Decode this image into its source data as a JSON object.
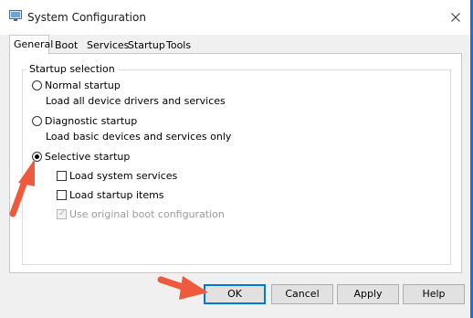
{
  "window": {
    "title": "System Configuration",
    "icon": "system-config-icon",
    "close_icon": "close-icon"
  },
  "tabs": [
    {
      "label": "General",
      "active": true
    },
    {
      "label": "Boot",
      "active": false
    },
    {
      "label": "Services",
      "active": false
    },
    {
      "label": "Startup",
      "active": false
    },
    {
      "label": "Tools",
      "active": false
    }
  ],
  "startup_selection": {
    "group_label": "Startup selection",
    "normal": {
      "label": "Normal startup",
      "description": "Load all device drivers and services",
      "selected": false
    },
    "diagnostic": {
      "label": "Diagnostic startup",
      "description": "Load basic devices and services only",
      "selected": false
    },
    "selective": {
      "label": "Selective startup",
      "selected": true,
      "options": [
        {
          "label": "Load system services",
          "checked": false,
          "enabled": true
        },
        {
          "label": "Load startup items",
          "checked": false,
          "enabled": true
        },
        {
          "label": "Use original boot configuration",
          "checked": true,
          "enabled": false
        }
      ]
    }
  },
  "buttons": {
    "ok": "OK",
    "cancel": "Cancel",
    "apply": "Apply",
    "help": "Help"
  },
  "annotations": {
    "arrow_color": "#f05a3c"
  }
}
